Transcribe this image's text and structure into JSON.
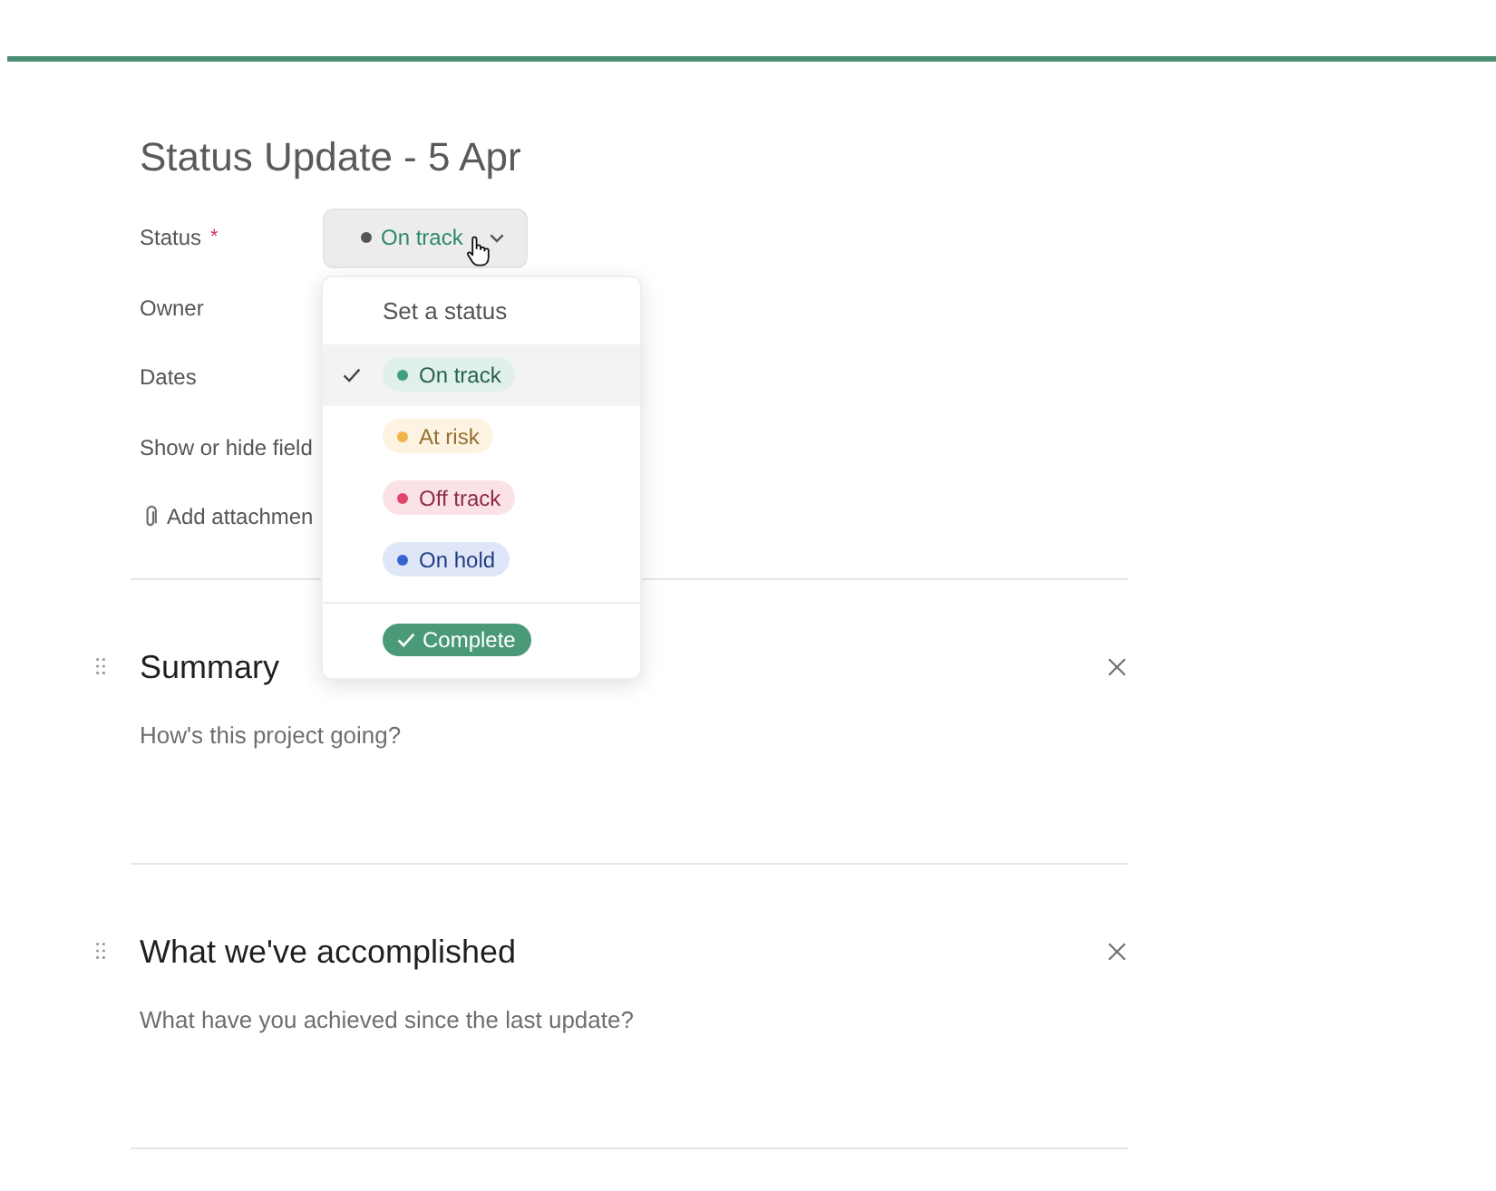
{
  "title": "Status Update - 5 Apr",
  "fields": [
    {
      "kind": "status",
      "label": "Status",
      "required_mark": "*",
      "value": "On track",
      "expanded": true
    },
    {
      "kind": "plain",
      "label": "Owner"
    },
    {
      "kind": "plain",
      "label": "Dates"
    },
    {
      "kind": "plain",
      "label": "Show or hide field"
    },
    {
      "kind": "attachment",
      "label": "Add attachmen"
    }
  ],
  "status_menu": {
    "heading": "Set a status",
    "options": [
      {
        "label": "On track",
        "color": "#3f9f7c",
        "selected": true
      },
      {
        "label": "At risk",
        "color": "#f1b44c",
        "selected": false
      },
      {
        "label": "Off track",
        "color": "#e2476a",
        "selected": false
      },
      {
        "label": "On hold",
        "color": "#3663d1",
        "selected": false
      }
    ],
    "complete": {
      "label": "Complete"
    }
  },
  "sections": [
    {
      "heading": "Summary",
      "placeholder": "How's this project going?"
    },
    {
      "heading": "What we've accomplished",
      "placeholder": "What have you achieved since the last update?"
    }
  ]
}
